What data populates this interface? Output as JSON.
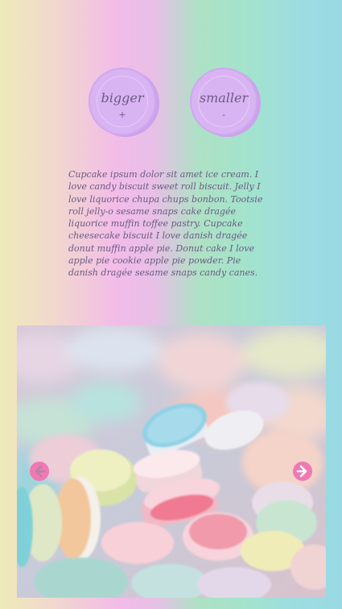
{
  "controls": {
    "bigger": {
      "label": "bigger",
      "sign": "+"
    },
    "smaller": {
      "label": "smaller",
      "sign": "-"
    }
  },
  "content": {
    "paragraph": "Cupcake ipsum dolor sit amet ice cream. I love candy biscuit sweet roll biscuit. Jelly I love liquorice chupa chups bonbon. Tootsie roll jelly-o sesame snaps cake dragée liquorice muffin toffee pastry. Cupcake cheesecake biscuit I love danish dragée donut muffin apple pie. Donut cake I love apple pie cookie apple pie powder. Pie danish dragée sesame snaps candy canes."
  },
  "slider": {
    "prev_icon": "arrow-left-icon",
    "next_icon": "arrow-right-icon",
    "accent_color": "#ee79b3"
  }
}
